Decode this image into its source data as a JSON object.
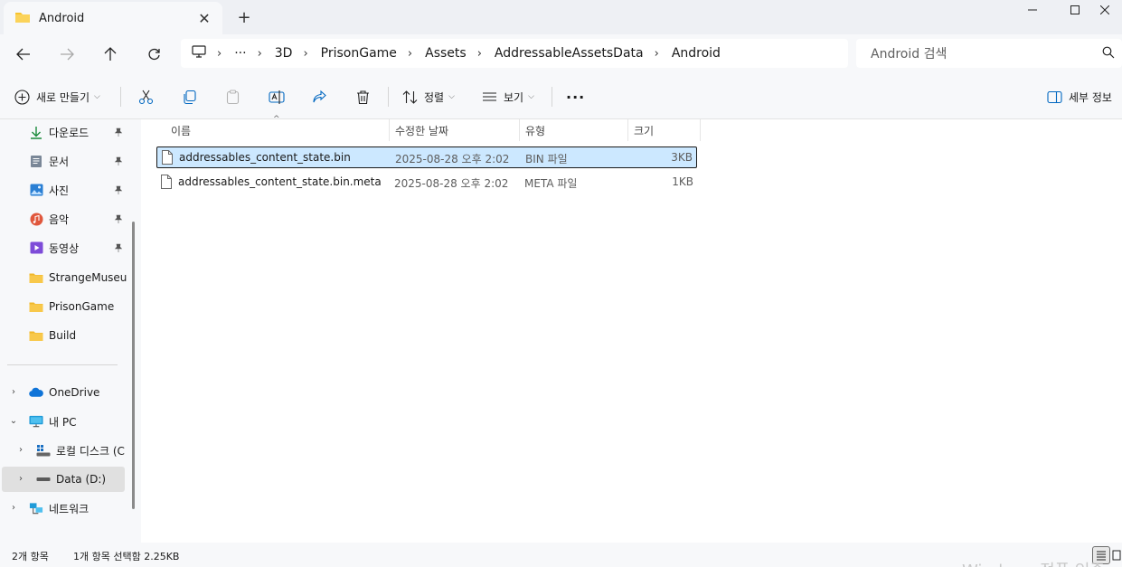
{
  "window": {
    "tab_title": "Android",
    "colors": {
      "accent": "#0078d4",
      "folder": "#f8c32e",
      "selection": "#cce8ff"
    }
  },
  "address": {
    "breadcrumbs": [
      "3D",
      "PrisonGame",
      "Assets",
      "AddressableAssetsData",
      "Android"
    ],
    "overflow": "···"
  },
  "search": {
    "placeholder": "Android 검색"
  },
  "commands": {
    "new": "새로 만들기",
    "sort": "정렬",
    "view": "보기",
    "more": "···",
    "details": "세부 정보"
  },
  "nav": {
    "quick_access": [
      {
        "label": "다운로드",
        "icon": "download-icon",
        "pinned": true
      },
      {
        "label": "문서",
        "icon": "document-icon",
        "pinned": true
      },
      {
        "label": "사진",
        "icon": "pictures-icon",
        "pinned": true
      },
      {
        "label": "음악",
        "icon": "music-icon",
        "pinned": true
      },
      {
        "label": "동영상",
        "icon": "video-icon",
        "pinned": true
      },
      {
        "label": "StrangeMuseum",
        "icon": "folder-icon",
        "pinned": false
      },
      {
        "label": "PrisonGame",
        "icon": "folder-icon",
        "pinned": false
      },
      {
        "label": "Build",
        "icon": "folder-icon",
        "pinned": false
      }
    ],
    "tree": [
      {
        "label": "OneDrive",
        "icon": "onedrive-icon"
      },
      {
        "label": "내 PC",
        "icon": "pc-icon"
      },
      {
        "label": "로컬 디스크 (C",
        "icon": "local-disk-icon"
      },
      {
        "label": "Data (D:)",
        "icon": "drive-icon"
      },
      {
        "label": "네트워크",
        "icon": "network-icon"
      }
    ]
  },
  "columns": {
    "name": "이름",
    "modified": "수정한 날짜",
    "type": "유형",
    "size": "크기"
  },
  "files": [
    {
      "name": "addressables_content_state.bin",
      "modified": "2025-08-28 오후 2:02",
      "type": "BIN 파일",
      "size": "3KB",
      "selected": true
    },
    {
      "name": "addressables_content_state.bin.meta",
      "modified": "2025-08-28 오후 2:02",
      "type": "META 파일",
      "size": "1KB",
      "selected": false
    }
  ],
  "status": {
    "count": "2개 항목",
    "selection": "1개 항목 선택함 2.25KB"
  },
  "watermark": "Windows 정품 인증"
}
